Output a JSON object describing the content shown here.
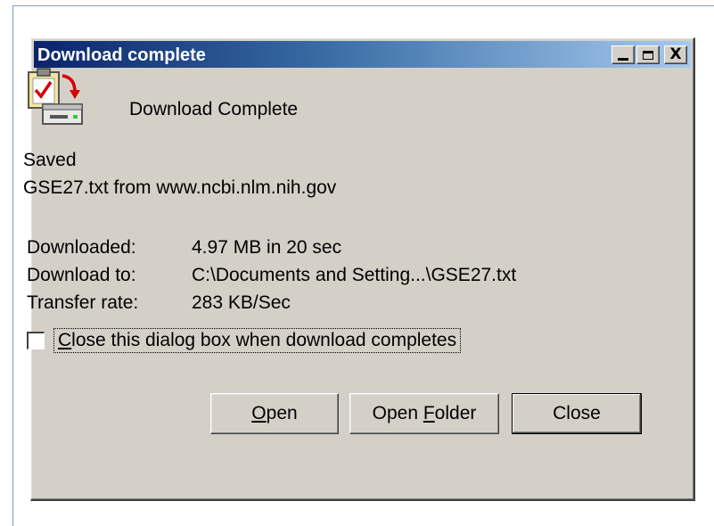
{
  "window": {
    "title": "Download complete",
    "controls": {
      "minimize_icon": "minimize-icon",
      "maximize_icon": "maximize-icon",
      "close_glyph": "X"
    }
  },
  "content": {
    "icon": "download-complete-icon",
    "heading": "Download Complete",
    "saved_label": "Saved",
    "saved_source": "GSE27.txt from www.ncbi.nlm.nih.gov"
  },
  "details": [
    {
      "key": "Downloaded:",
      "value": "4.97 MB in 20 sec"
    },
    {
      "key": "Download to:",
      "value": "C:\\Documents and Setting...\\GSE27.txt"
    },
    {
      "key": "Transfer rate:",
      "value": "283 KB/Sec"
    }
  ],
  "checkbox": {
    "checked": false,
    "label_first": "C",
    "label_rest": "lose this dialog box when download completes"
  },
  "buttons": {
    "open": {
      "mnemonic": "O",
      "rest": "pen"
    },
    "open_folder": {
      "before": "Open ",
      "mnemonic": "F",
      "after": "older"
    },
    "close": {
      "label": "Close"
    }
  }
}
